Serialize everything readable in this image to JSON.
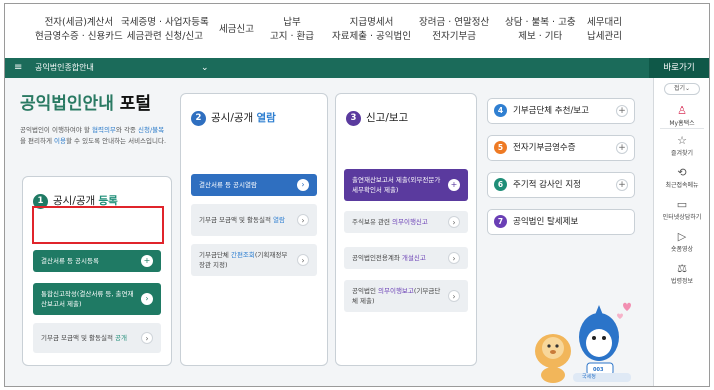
{
  "nav": [
    {
      "line1": "전자(세금)계산서",
      "line2": "현금영수증 · 신용카드"
    },
    {
      "line1": "국세증명 · 사업자등록",
      "line2": "세금관련 신청/신고"
    },
    {
      "line1": "세금신고",
      "line2": ""
    },
    {
      "line1": "납부",
      "line2": "고지 · 환급"
    },
    {
      "line1": "지급명세서",
      "line2": "자료제출 · 공익법인"
    },
    {
      "line1": "장려금 · 연말정산",
      "line2": "전자기부금"
    },
    {
      "line1": "상담 · 불복 · 고충",
      "line2": "제보 · 기타"
    },
    {
      "line1": "세무대리",
      "line2": "납세관리"
    }
  ],
  "breadcrumb": {
    "menu_icon": "≡",
    "title": "공익법인종합안내",
    "chevron": "⌄",
    "shortcut": "바로가기"
  },
  "portal": {
    "title_green": "공익법인안내",
    "title_dark": " 포털",
    "desc_parts": [
      {
        "t": "공익법인이 이행하여야 할 ",
        "hl": false
      },
      {
        "t": "협력의무",
        "hl": true
      },
      {
        "t": "와 각종 ",
        "hl": false
      },
      {
        "t": "신청/불복",
        "hl": true
      },
      {
        "t": "을 편리하게 ",
        "hl": false
      },
      {
        "t": "이용",
        "hl": true
      },
      {
        "t": "할 수 있도록 안내하는 서비스입니다.",
        "hl": false
      }
    ]
  },
  "col1": {
    "num": "1",
    "label": "공시/공개 ",
    "label_em": "등록",
    "buttons": [
      {
        "text": "결산서류 등 공시등록",
        "icon": "+",
        "style": "dark"
      },
      {
        "text": "통합신고작성(결산서류 등, 출연재산보고서 제출)",
        "icon": "›",
        "style": "dark"
      },
      {
        "text": "기부금 모금액 및 활동실적 ",
        "text_em": "공개",
        "icon": "›",
        "style": "light"
      }
    ]
  },
  "col2": {
    "num": "2",
    "label": "공시/공개 ",
    "label_em": "열람",
    "buttons": [
      {
        "text": "결산서류 등 공시열람",
        "icon": "›",
        "style": "dark"
      },
      {
        "text": "기부금 모금액 및 활동실적 ",
        "text_em": "열람",
        "icon": "›",
        "style": "light"
      },
      {
        "text": "기부금단체 ",
        "text_em": "간편조회",
        "text_after": "(기획재정부장관 지정)",
        "icon": "›",
        "style": "light"
      }
    ]
  },
  "col3": {
    "num": "3",
    "label": "신고/보고",
    "label_em": "",
    "buttons": [
      {
        "text": "출연재산보고서 제출(외부전문가 세무확인서 제출)",
        "icon": "+",
        "style": "dark"
      },
      {
        "text": "주식보유 관련 ",
        "text_em": "의무이행신고",
        "icon": "›",
        "style": "light"
      },
      {
        "text": "공익법인전용계좌 ",
        "text_em": "개설신고",
        "icon": "›",
        "style": "light"
      },
      {
        "text": "공익법인 ",
        "text_em": "의무이행보고",
        "text_after": "(기부금단체 제출)",
        "icon": "›",
        "style": "light"
      }
    ]
  },
  "right_items": [
    {
      "num": "4",
      "label": "기부금단체 추천/보고",
      "color": "#2f7fd1",
      "plus": "+"
    },
    {
      "num": "5",
      "label": "전자기부금영수증",
      "color": "#ee7a24",
      "plus": "+"
    },
    {
      "num": "6",
      "label": "주기적 감사인 지정",
      "color": "#1f8e78",
      "plus": "+"
    },
    {
      "num": "7",
      "label": "공익법인 탈세제보",
      "color": "#6a3fb5",
      "plus": ""
    }
  ],
  "sidebar": {
    "fold": "접기⌄",
    "items": [
      {
        "icon": "♙",
        "label": "My홈택스",
        "red": true
      },
      {
        "icon": "☆",
        "label": "즐겨찾기",
        "red": false
      },
      {
        "icon": "⟲",
        "label": "최근접속메뉴",
        "red": false
      },
      {
        "icon": "▭",
        "label": "인터넷상담하기",
        "red": false
      },
      {
        "icon": "▷",
        "label": "숏폼영상",
        "red": false
      },
      {
        "icon": "⚖",
        "label": "법령정보",
        "red": false
      }
    ]
  },
  "mascot": {
    "tag": "003",
    "banner": "국세청"
  },
  "colors": {
    "green": "#2a7a63",
    "col1_btn": "#1f7a64",
    "col2_btn": "#2f6fc0",
    "col3_btn": "#5a3a9e",
    "em_green": "#1f8e78",
    "em_blue": "#2f7fd1",
    "em_purple": "#6a3fb5"
  }
}
